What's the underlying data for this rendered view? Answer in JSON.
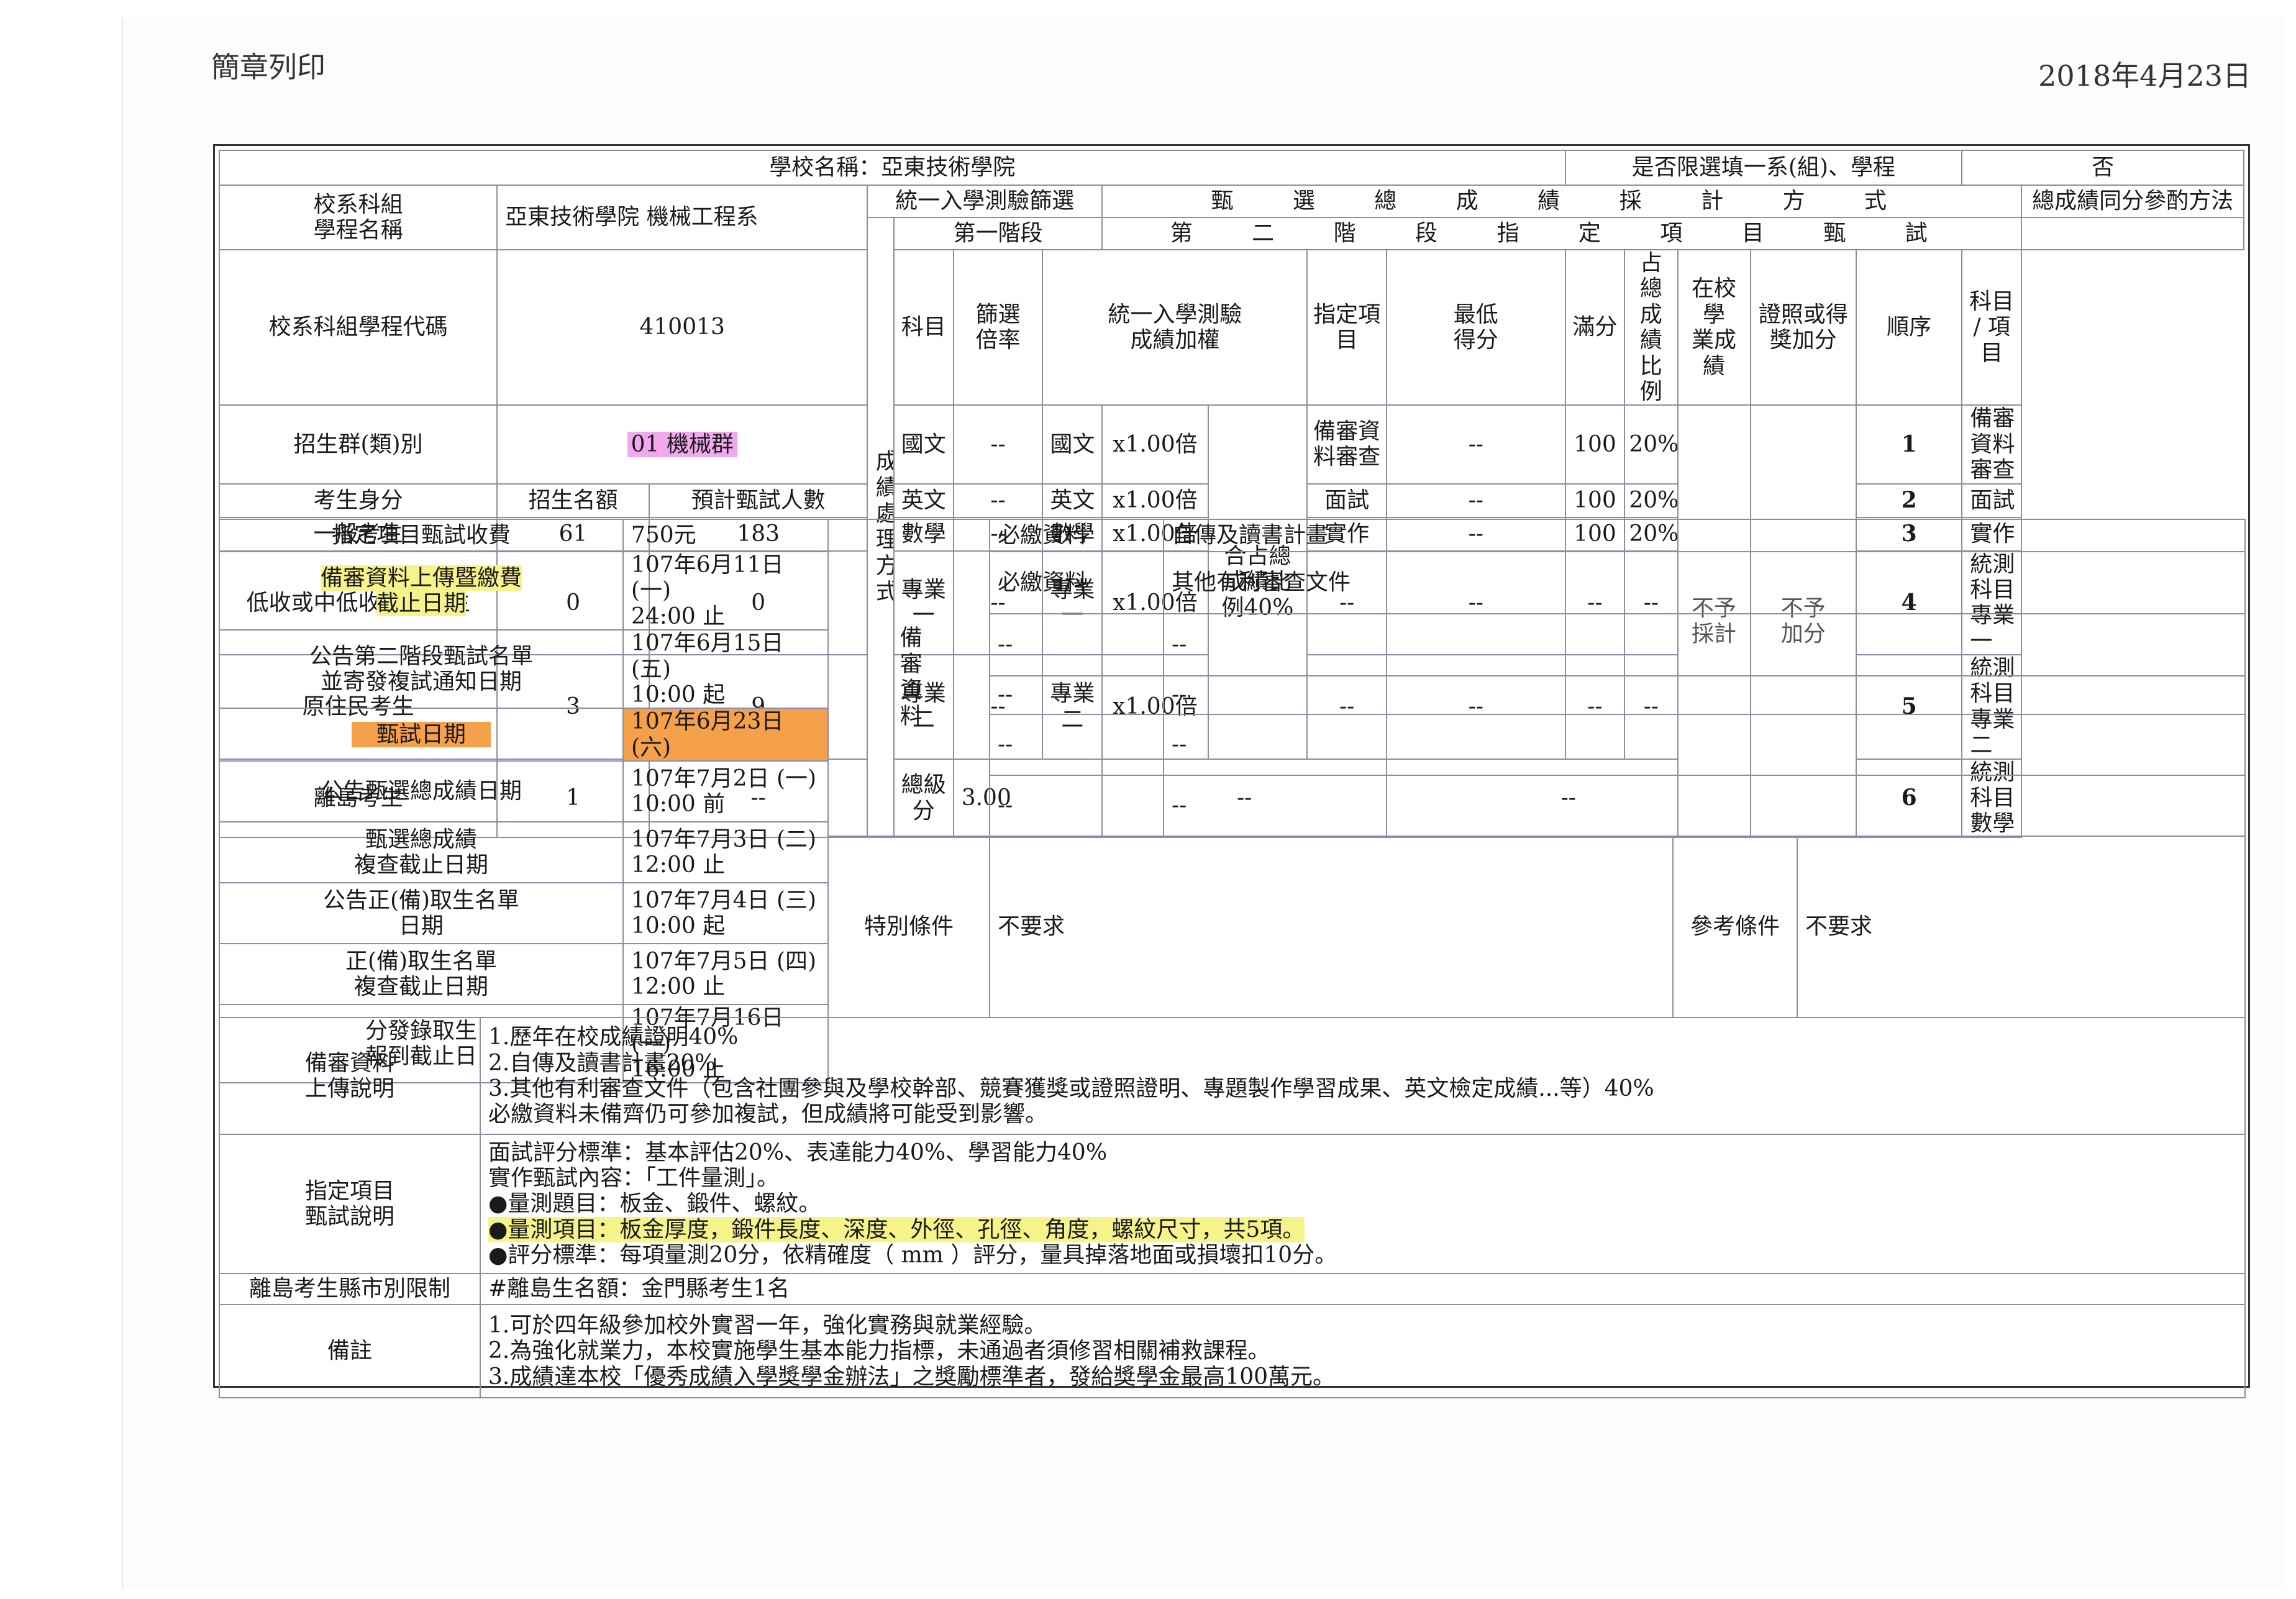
{
  "header": {
    "title": "簡章列印",
    "date": "2018年4月23日"
  },
  "top": {
    "school_label": "學校名稱：亞東技術學院",
    "limit_label": "是否限選填一系(組)、學程",
    "limit_value": "否"
  },
  "dept": {
    "name_label": "校系科組\n學程名稱",
    "name_value": "亞東技術學院 機械工程系",
    "code_label": "校系科組學程代碼",
    "code_value": "410013",
    "group_label": "招生群(類)別",
    "group_value": "01 機械群"
  },
  "quota": {
    "headers": [
      "考生身分",
      "招生名額",
      "預計甄試人數"
    ],
    "rows": [
      {
        "label": "一般考生",
        "quota": "61",
        "planned": "183"
      },
      {
        "label": "低收或中低收入戶考生",
        "quota": "0",
        "planned": "0"
      },
      {
        "label": "原住民考生",
        "quota": "3",
        "planned": "9"
      },
      {
        "label": "離島考生",
        "quota": "1",
        "planned": "--"
      }
    ]
  },
  "stage1": {
    "title": "統一入學測驗篩選",
    "subtitle": "第一階段",
    "side_label": "成績處理方式",
    "col_subject": "科目",
    "col_ratio": "篩選\n倍率",
    "rows": [
      {
        "subject": "國文",
        "ratio": "--"
      },
      {
        "subject": "英文",
        "ratio": "--"
      },
      {
        "subject": "數學",
        "ratio": "--"
      },
      {
        "subject": "專業一",
        "ratio": "--"
      },
      {
        "subject": "專業二",
        "ratio": "--"
      }
    ],
    "total_label": "總級分",
    "total_value": "3.00"
  },
  "stage2": {
    "title": "甄 選 總 成 績 採 計 方 式",
    "subtitle": "第 二 階 段 指 定 項 目 甄 試",
    "col_weight": "統一入學測驗\n成績加權",
    "col_item": "指定項目",
    "col_min": "最低\n得分",
    "col_full": "滿分",
    "col_pct": "占總成\n績比例",
    "col_school": "在校學\n業成績",
    "col_bonus": "證照或得\n獎加分",
    "weights": [
      {
        "subject": "國文",
        "weight": "x1.00倍"
      },
      {
        "subject": "英文",
        "weight": "x1.00倍"
      },
      {
        "subject": "數學",
        "weight": "x1.00倍"
      },
      {
        "subject": "專業一",
        "weight": "x1.00倍"
      },
      {
        "subject": "專業二",
        "weight": "x1.00倍"
      }
    ],
    "merge_label": "合占總\n成績比\n例40%",
    "items": [
      {
        "item": "備審資料審查",
        "min": "--",
        "full": "100",
        "pct": "20%"
      },
      {
        "item": "面試",
        "min": "--",
        "full": "100",
        "pct": "20%"
      },
      {
        "item": "實作",
        "min": "--",
        "full": "100",
        "pct": "20%"
      },
      {
        "item": "--",
        "min": "--",
        "full": "--",
        "pct": "--"
      },
      {
        "item": "--",
        "min": "--",
        "full": "--",
        "pct": "--"
      }
    ],
    "school_value": "不予\n採計",
    "bonus_value": "不予\n加分",
    "total_row_a": "--",
    "total_row_b": "--"
  },
  "tie": {
    "title": "總成績同分參酌方法",
    "col_order": "順序",
    "col_subject": "科目 / 項目",
    "rows": [
      {
        "no": "1",
        "item": "備審資料審查"
      },
      {
        "no": "2",
        "item": "面試"
      },
      {
        "no": "3",
        "item": "實作"
      },
      {
        "no": "4",
        "item": "統測科目專業一"
      },
      {
        "no": "5",
        "item": "統測科目專業二"
      },
      {
        "no": "6",
        "item": "統測科目數學"
      }
    ]
  },
  "schedule": [
    {
      "label": "指定項目甄試收費",
      "value": "750元"
    },
    {
      "label": "備審資料上傳暨繳費\n截止日期",
      "value": "107年6月11日 (一)\n24:00 止"
    },
    {
      "label": "公告第二階段甄試名單\n並寄發複試通知日期",
      "value": "107年6月15日 (五)\n10:00 起"
    },
    {
      "label": "甄試日期",
      "value": "107年6月23日 (六)"
    },
    {
      "label": "公告甄選總成績日期",
      "value": "107年7月2日 (一)\n10:00 前"
    },
    {
      "label": "甄選總成績\n複查截止日期",
      "value": "107年7月3日 (二)\n12:00 止"
    },
    {
      "label": "公告正(備)取生名單\n日期",
      "value": "107年7月4日 (三)\n10:00 起"
    },
    {
      "label": "正(備)取生名單\n複查截止日期",
      "value": "107年7月5日 (四)\n12:00 止"
    },
    {
      "label": "分發錄取生\n報到截止日",
      "value": "107年7月16日 (一)\n16:00 止"
    }
  ],
  "review": {
    "side_label": "備審資料",
    "rows": [
      {
        "type": "必繳資料",
        "content": "自傳及讀書計畫"
      },
      {
        "type": "必繳資料",
        "content": "其他有利審查文件"
      },
      {
        "type": "--",
        "content": "--"
      },
      {
        "type": "--",
        "content": "--"
      },
      {
        "type": "--",
        "content": "--"
      },
      {
        "type": "--",
        "content": "--"
      }
    ]
  },
  "conditions": {
    "special_label": "特別條件",
    "special_value": "不要求",
    "ref_label": "參考條件",
    "ref_value": "不要求"
  },
  "upload": {
    "label": "備審資料\n上傳說明",
    "lines": [
      "1.歷年在校成績證明40%",
      "2.自傳及讀書計畫20%",
      "3.其他有利審查文件（包含社團參與及學校幹部、競賽獲獎或證照證明、專題製作學習成果、英文檢定成績...等）40%",
      "必繳資料未備齊仍可參加複試，但成績將可能受到影響。"
    ]
  },
  "exam": {
    "label": "指定項目\n甄試說明",
    "lines": [
      "面試評分標準：基本評估20%、表達能力40%、學習能力40%",
      "實作甄試內容：「工件量測」。",
      "●量測題目：板金、鍛件、螺紋。",
      "●量測項目：板金厚度，鍛件長度、深度、外徑、孔徑、角度，螺紋尺寸，共5項。",
      "●評分標準：每項量測20分，依精確度（ mm ）評分，量具掉落地面或損壞扣10分。"
    ]
  },
  "island": {
    "label": "離島考生縣市別限制",
    "value": "#離島生名額：金門縣考生1名"
  },
  "notes": {
    "label": "備註",
    "lines": [
      "1.可於四年級參加校外實習一年，強化實務與就業經驗。",
      "2.為強化就業力，本校實施學生基本能力指標，未通過者須修習相關補救課程。",
      "3.成績達本校「優秀成績入學獎學金辦法」之獎勵標準者，發給獎學金最高100萬元。"
    ]
  },
  "colors": {
    "border": "#8a8ea4",
    "highlight_yellow": "#f7f38b",
    "highlight_orange": "#f5a04a",
    "highlight_pink": "#f2a8ef"
  }
}
